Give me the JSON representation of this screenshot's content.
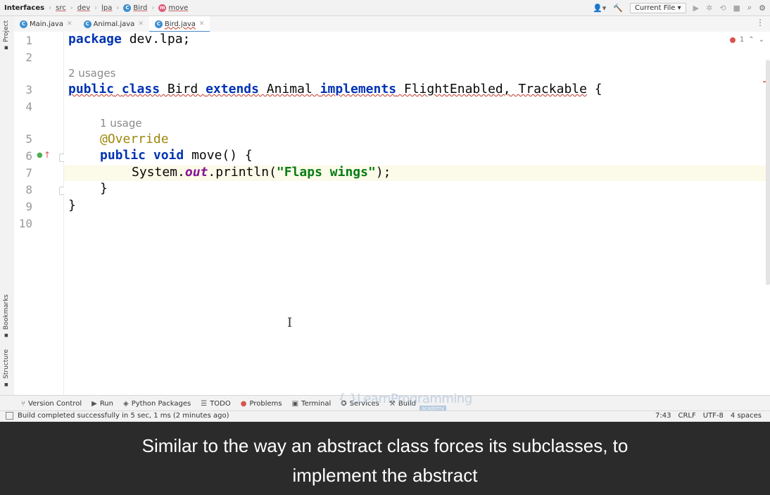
{
  "navbar": {
    "crumbs": [
      "Interfaces",
      "src",
      "dev",
      "lpa",
      "Bird",
      "move"
    ],
    "run_config": "Current File",
    "user_icon": "user-icon",
    "build_icon": "hammer-icon",
    "run_icon": "run-icon",
    "debug_icon": "debug-icon",
    "coverage_icon": "coverage-icon",
    "stop_icon": "stop-icon",
    "search_icon": "search-icon",
    "settings_icon": "gear-icon"
  },
  "tabs": [
    {
      "label": "Main.java",
      "active": false
    },
    {
      "label": "Animal.java",
      "active": false
    },
    {
      "label": "Bird.java",
      "active": true
    }
  ],
  "left_tools": [
    "Project",
    "Bookmarks",
    "Structure"
  ],
  "editor": {
    "line_numbers": [
      "1",
      "2",
      "3",
      "4",
      "5",
      "6",
      "7",
      "8",
      "9",
      "10"
    ],
    "usages_class": "2 usages",
    "usages_method": "1 usage",
    "code": {
      "l1_kw": "package",
      "l1_rest": " dev.lpa;",
      "l3_kw1": "public",
      "l3_kw2": "class",
      "l3_name": " Bird ",
      "l3_kw3": "extends",
      "l3_super": " Animal ",
      "l3_kw4": "implements",
      "l3_ifaces": " FlightEnabled, Trackable",
      "l3_brace": " {",
      "l5_ann": "@Override",
      "l6_kw1": "public",
      "l6_kw2": "void",
      "l6_rest": " move() {",
      "l7_a": "System.",
      "l7_field": "out",
      "l7_b": ".println(",
      "l7_str": "\"Flaps wings\"",
      "l7_c": ");",
      "l8": "}",
      "l9": "}"
    },
    "error_count": "1"
  },
  "tool_windows": [
    {
      "label": "Version Control",
      "icon": "branch-icon"
    },
    {
      "label": "Run",
      "icon": "play-icon"
    },
    {
      "label": "Python Packages",
      "icon": "packages-icon"
    },
    {
      "label": "TODO",
      "icon": "list-icon"
    },
    {
      "label": "Problems",
      "icon": "error-icon"
    },
    {
      "label": "Terminal",
      "icon": "terminal-icon"
    },
    {
      "label": "Services",
      "icon": "services-icon"
    },
    {
      "label": "Build",
      "icon": "hammer-icon"
    }
  ],
  "watermark": {
    "text": "{ }LearnProgramming",
    "sub": "academy"
  },
  "status": {
    "message": "Build completed successfully in 5 sec, 1 ms (2 minutes ago)",
    "position": "7:43",
    "line_sep": "CRLF",
    "encoding": "UTF-8",
    "indent": "4 spaces"
  },
  "subtitle": {
    "line1": "Similar to the way an abstract class forces its subclasses, to",
    "line2": "implement the abstract"
  }
}
